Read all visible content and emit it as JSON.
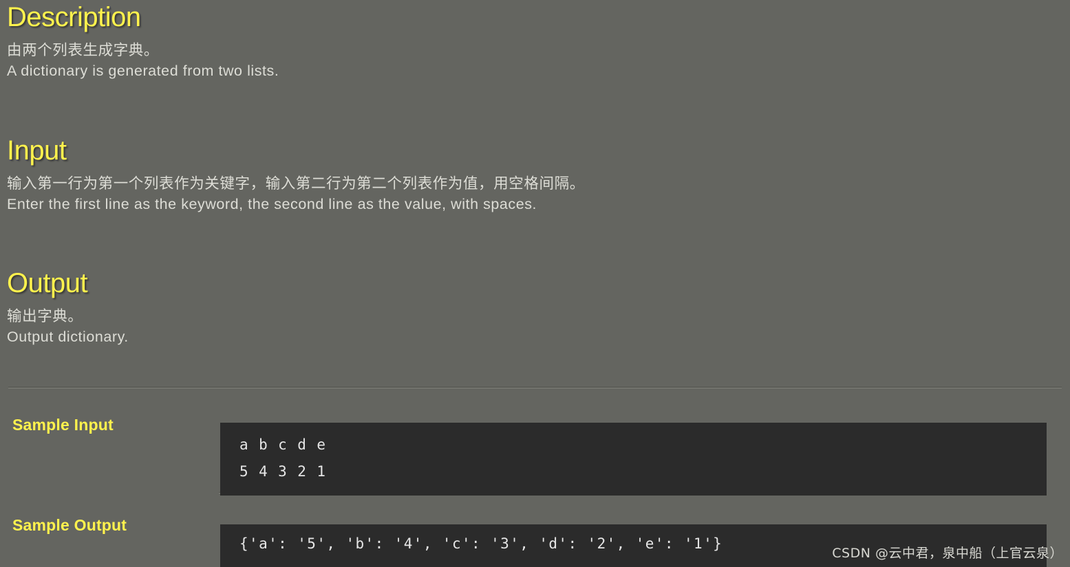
{
  "theme": {
    "background": "#646560",
    "heading_color": "#fff24d",
    "body_text_color": "#ddddd6",
    "code_background": "#2b2b2b",
    "code_text_color": "#e6e6e6",
    "divider_dark": "#4c4d48",
    "divider_light": "#85867f"
  },
  "sections": {
    "description": {
      "heading": "Description",
      "text_cn": "由两个列表生成字典。",
      "text_en": "A dictionary is generated from two lists."
    },
    "input": {
      "heading": "Input",
      "text_cn": "输入第一行为第一个列表作为关键字，输入第二行为第二个列表作为值，用空格间隔。",
      "text_en": "Enter the first line as the keyword, the second line as the value, with spaces."
    },
    "output": {
      "heading": "Output",
      "text_cn": "输出字典。",
      "text_en": "Output dictionary."
    }
  },
  "samples": {
    "input_label": "Sample Input",
    "input_code": "a b c d e\n5 4 3 2 1",
    "output_label": "Sample Output",
    "output_code": "{'a': '5', 'b': '4', 'c': '3', 'd': '2', 'e': '1'}"
  },
  "watermark": {
    "text": "CSDN @云中君，泉中船（上官云泉）"
  }
}
